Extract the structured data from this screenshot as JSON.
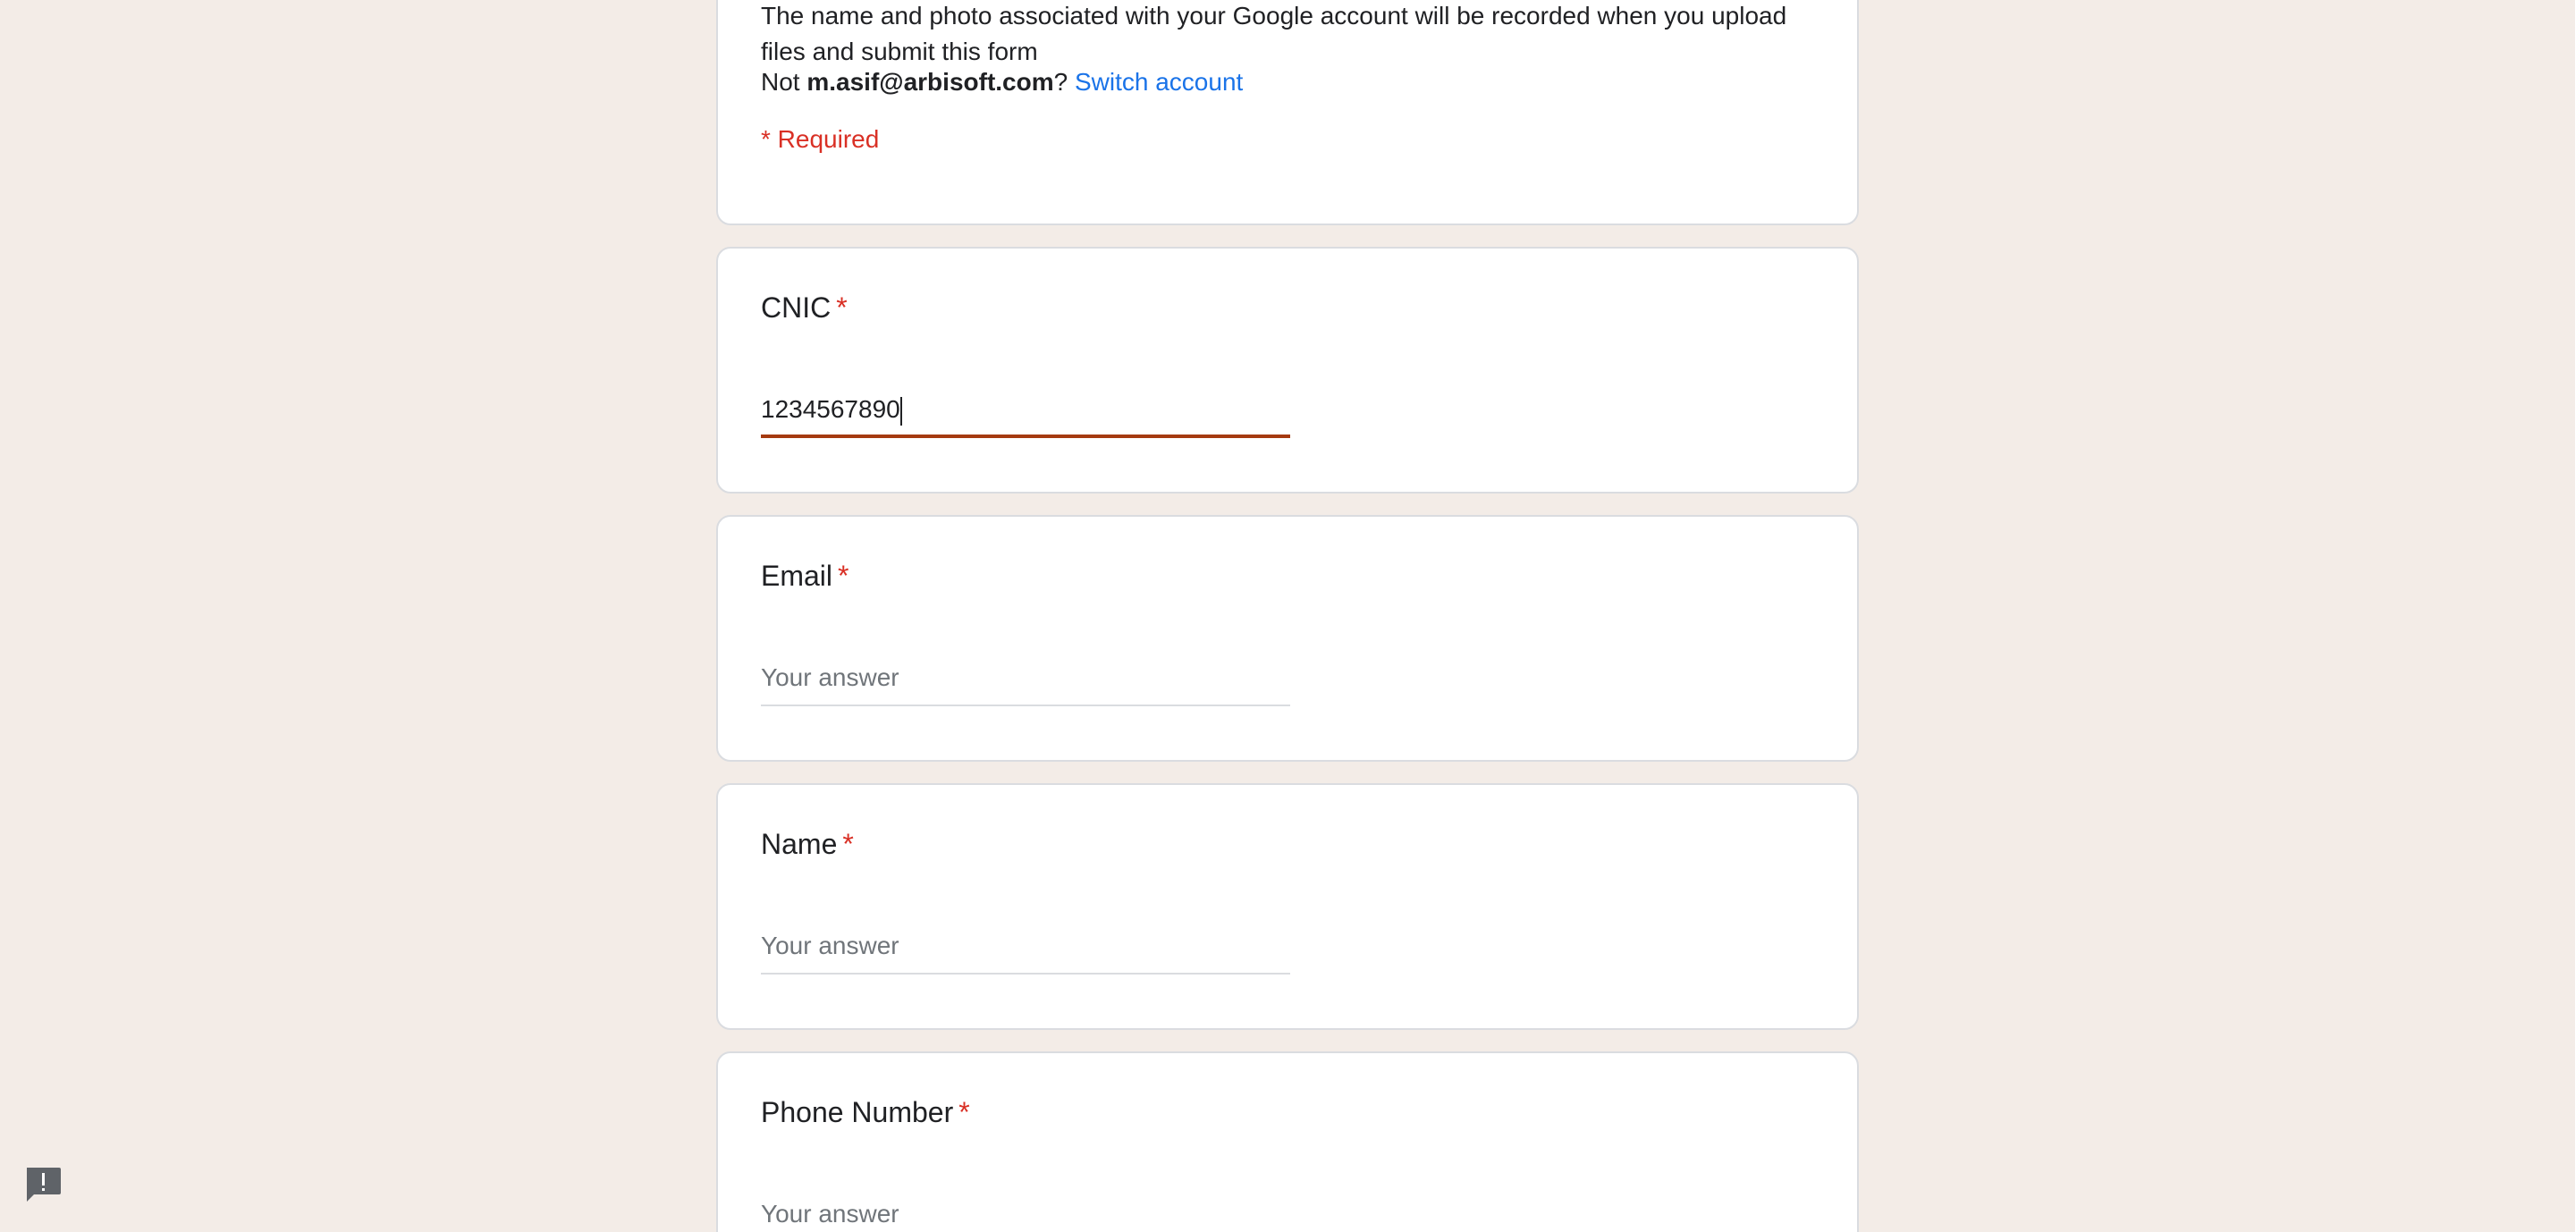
{
  "header": {
    "notice": "The name and photo associated with your Google account will be recorded when you upload files and submit this form",
    "account_prefix": "Not ",
    "account_email": "m.asif@arbisoft.com",
    "account_suffix": "?",
    "switch_label": "Switch account",
    "required_note": "* Required"
  },
  "questions": [
    {
      "title": "CNIC",
      "required_mark": "*",
      "value": "1234567890",
      "placeholder": "Your answer",
      "active": true
    },
    {
      "title": "Email",
      "required_mark": "*",
      "value": "",
      "placeholder": "Your answer",
      "active": false
    },
    {
      "title": "Name",
      "required_mark": "*",
      "value": "",
      "placeholder": "Your answer",
      "active": false
    },
    {
      "title": "Phone Number",
      "required_mark": "*",
      "value": "",
      "placeholder": "Your answer",
      "active": false
    }
  ],
  "colors": {
    "background": "#f3ece7",
    "required": "#d93025",
    "link": "#1a73e8",
    "active_underline": "#a53a10"
  },
  "icons": {
    "feedback": "feedback-icon"
  }
}
